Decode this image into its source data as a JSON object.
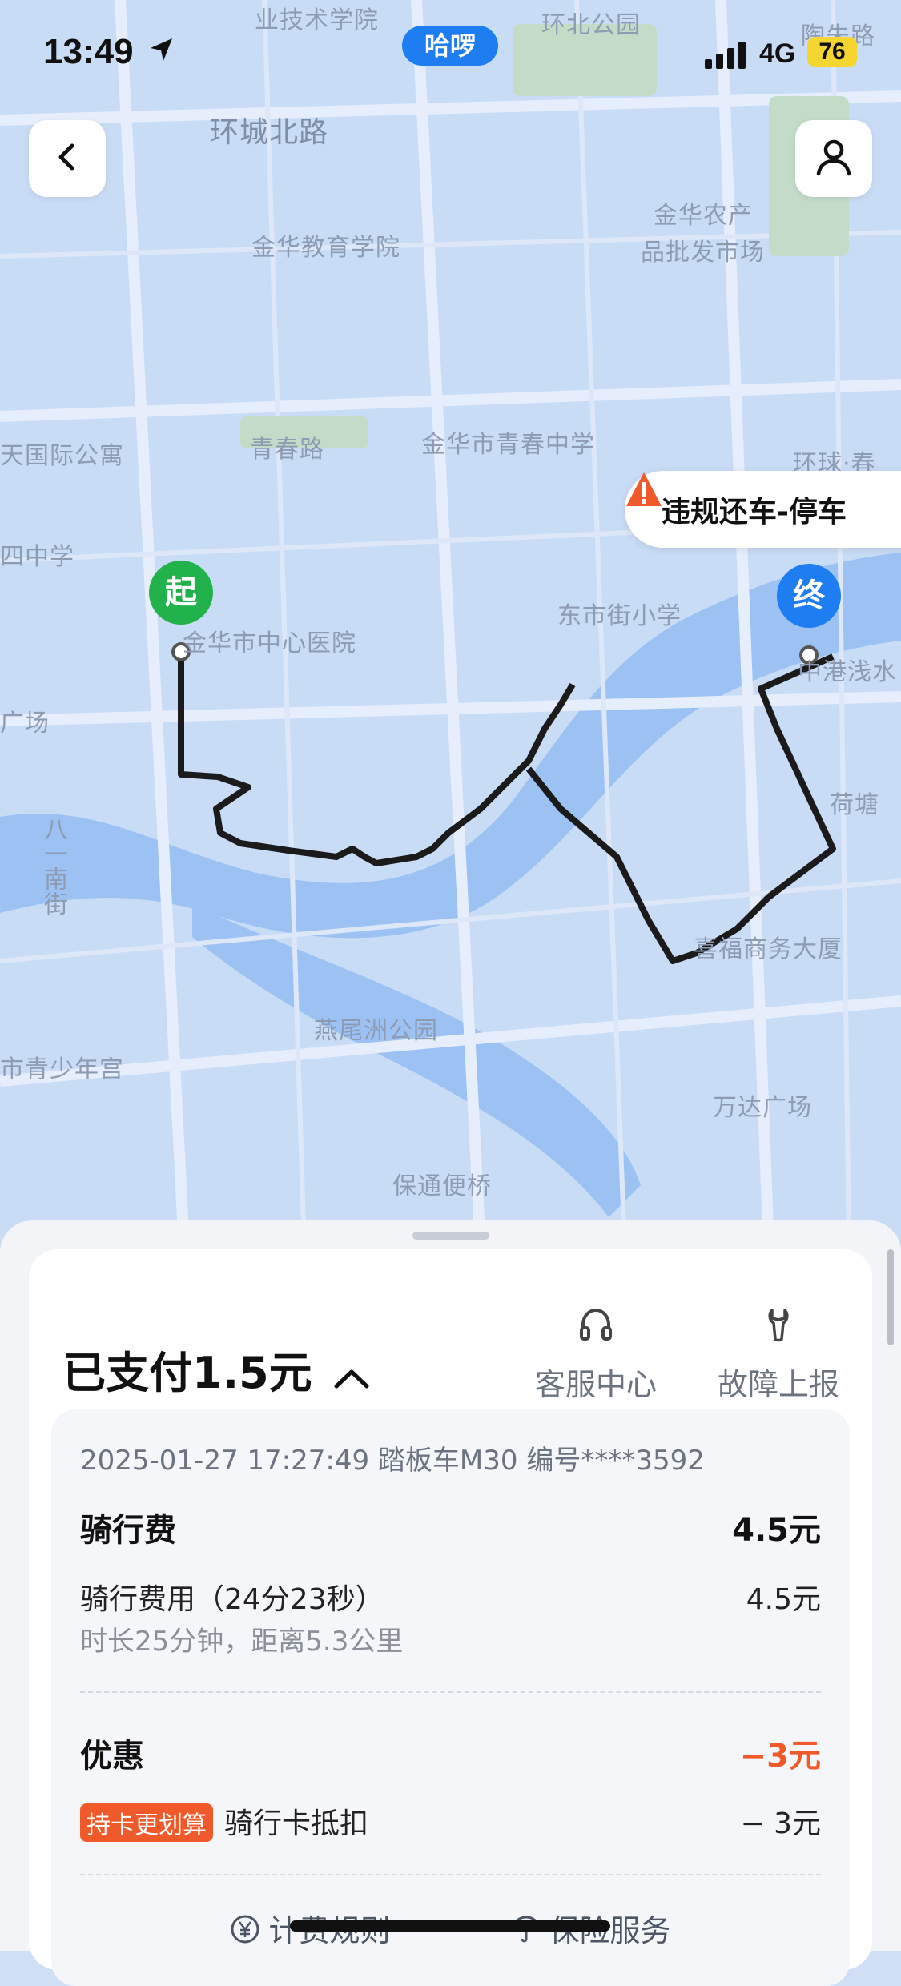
{
  "status_bar": {
    "time": "13:49",
    "app_pill": "哈啰",
    "network": "4G",
    "battery": "76"
  },
  "map": {
    "labels": [
      "业技术学院",
      "环北公园",
      "陶朱路",
      "环城北路",
      "金华农产",
      "品批发市场",
      "金华教育学院",
      "天国际公寓",
      "青春路",
      "金华市青春中学",
      "环球·春",
      "四中学",
      "东市街小学",
      "金华市中心医院",
      "中港浅水",
      "广场",
      "荷塘",
      "八一南街",
      "喜福商务大厦",
      "燕尾洲公园",
      "市青少年宫",
      "万达广场",
      "保通便桥"
    ],
    "start_pin": "起",
    "end_pin": "终",
    "warning": "违规还车-停车"
  },
  "sheet": {
    "paid": "已支付1.5元",
    "tools": [
      {
        "label": "客服中心",
        "icon": "headset-icon"
      },
      {
        "label": "故障上报",
        "icon": "wrench-icon"
      }
    ],
    "meta": "2025-01-27 17:27:49 踏板车M30 编号****3592",
    "ride_fee_title": "骑行费",
    "ride_fee_total": "4.5元",
    "ride_fee_item": "骑行费用（24分23秒）",
    "ride_fee_item_value": "4.5元",
    "ride_stats": "时长25分钟，距离5.3公里",
    "discount_title": "优惠",
    "discount_total": "−3元",
    "discount_badge": "持卡更划算",
    "discount_item": "骑行卡抵扣",
    "discount_item_value": "− 3元",
    "links": [
      "计费规则",
      "保险服务"
    ]
  },
  "colors": {
    "accent_blue": "#1e7df0",
    "start_green": "#22b24c",
    "discount_red": "#f05a2a"
  }
}
